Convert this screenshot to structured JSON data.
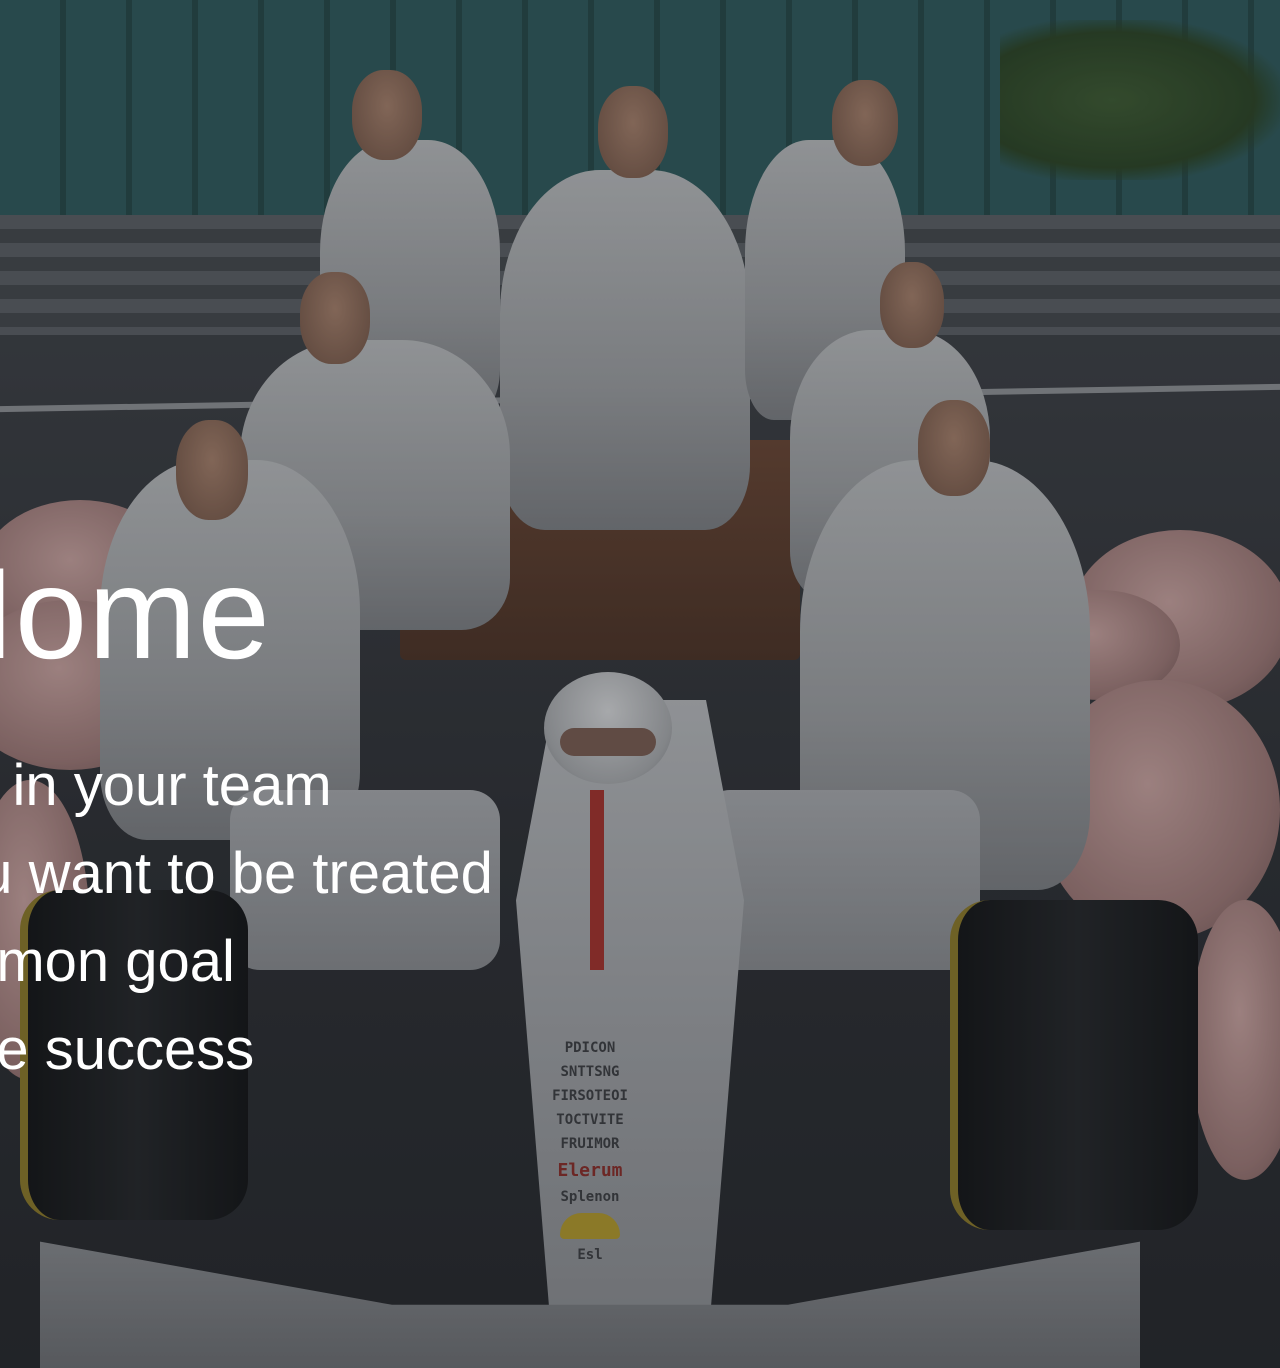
{
  "slide": {
    "title": "Home",
    "bullets": [
      "nt in your team",
      "ou want to be treated",
      "mmon goal",
      "the success"
    ]
  },
  "car_livery": {
    "lines": [
      "PDICON",
      "SNTTSNG",
      "FIRSOTEOI",
      "TOCTVITE",
      "FRUIMOR"
    ],
    "brand_line": "Elerum",
    "sponsor": "Splenon",
    "bottom": "Esl"
  },
  "colors": {
    "text": "#ffffff",
    "livery_red": "#a5322d",
    "overlay": "rgba(20,22,26,0.25)"
  }
}
